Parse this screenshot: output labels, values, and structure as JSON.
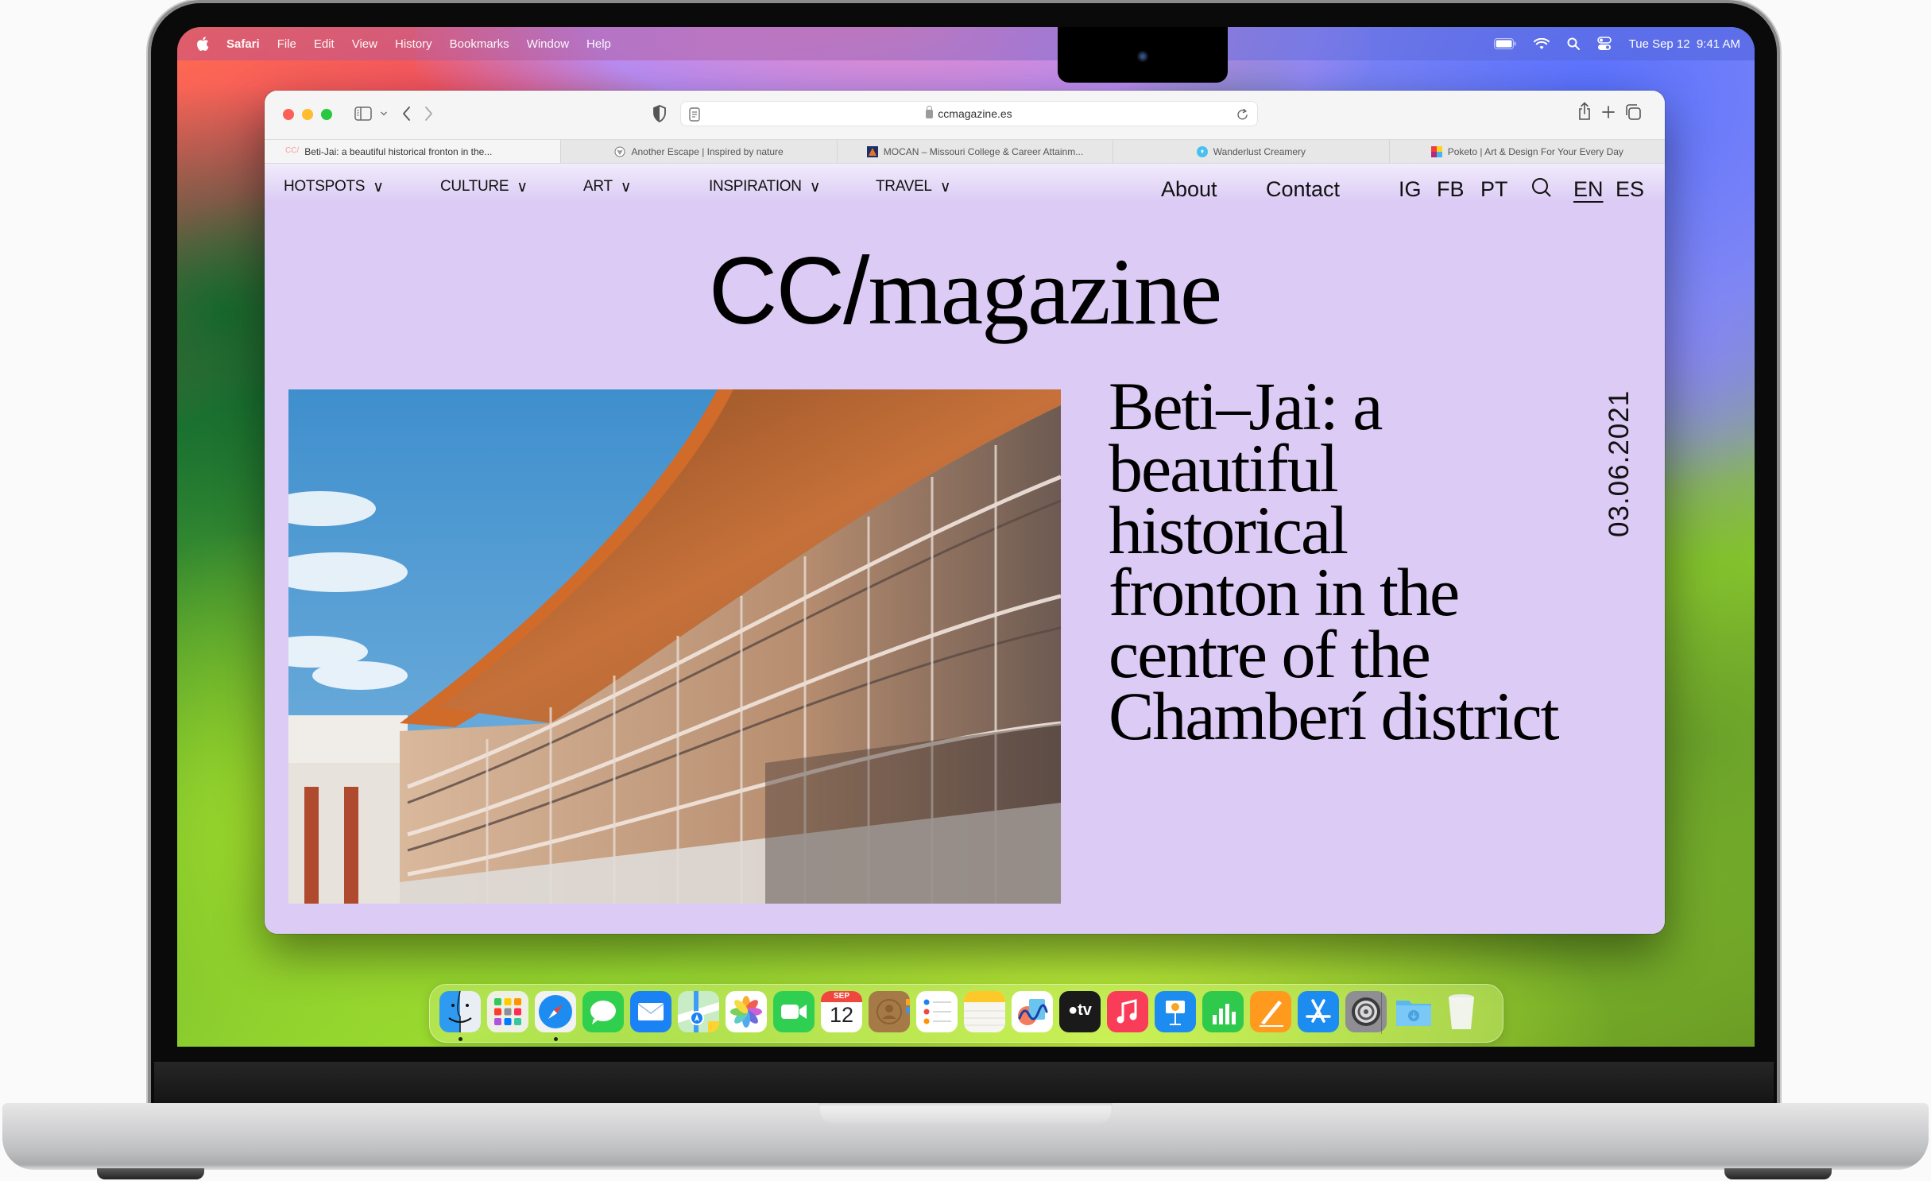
{
  "menubar": {
    "app_name": "Safari",
    "items": [
      "File",
      "Edit",
      "View",
      "History",
      "Bookmarks",
      "Window",
      "Help"
    ],
    "status_icons": [
      "battery-icon",
      "wifi-icon",
      "spotlight-search-icon",
      "control-center-icon"
    ],
    "clock": "Tue Sep 12  9:41 AM"
  },
  "safari": {
    "address": "ccmagazine.es",
    "tabs": [
      {
        "title": "Beti-Jai: a beautiful historical fronton in the...",
        "favicon": "cc-favicon",
        "active": true
      },
      {
        "title": "Another Escape | Inspired by nature",
        "favicon": "another-escape-favicon",
        "active": false
      },
      {
        "title": "MOCAN – Missouri College & Career Attainm...",
        "favicon": "mocan-favicon",
        "active": false
      },
      {
        "title": "Wanderlust Creamery",
        "favicon": "wanderlust-favicon",
        "active": false
      },
      {
        "title": "Poketo | Art & Design For Your Every Day",
        "favicon": "poketo-favicon",
        "active": false
      }
    ]
  },
  "page": {
    "nav_left": [
      {
        "label": "HOTSPOTS",
        "arrow": "∨"
      },
      {
        "label": "CULTURE",
        "arrow": "∨"
      },
      {
        "label": "ART",
        "arrow": "∨"
      },
      {
        "label": "INSPIRATION",
        "arrow": "∨"
      },
      {
        "label": "TRAVEL",
        "arrow": "∨"
      }
    ],
    "nav_right": {
      "about": "About",
      "contact": "Contact",
      "social": [
        "IG",
        "FB",
        "PT"
      ],
      "languages": [
        "EN",
        "ES"
      ],
      "active_language": "EN"
    },
    "masthead": {
      "prefix": "CC/",
      "suffix": "magazine"
    },
    "article": {
      "headline_lines": [
        "Beti–Jai: a",
        "beautiful historical",
        "fronton in the",
        "centre of the",
        "Chamberí district"
      ],
      "date": "03.06.2021",
      "image_alt": "Beti-Jai fronton arcade balconies under blue sky"
    },
    "background_color": "#dccbf5"
  },
  "dock": {
    "apps": [
      {
        "name": "Finder",
        "running": true
      },
      {
        "name": "Launchpad",
        "running": false
      },
      {
        "name": "Safari",
        "running": true
      },
      {
        "name": "Messages",
        "running": false
      },
      {
        "name": "Mail",
        "running": false
      },
      {
        "name": "Maps",
        "running": false
      },
      {
        "name": "Photos",
        "running": false
      },
      {
        "name": "FaceTime",
        "running": false
      },
      {
        "name": "Calendar",
        "running": false,
        "month": "SEP",
        "day": "12"
      },
      {
        "name": "Contacts",
        "running": false
      },
      {
        "name": "Reminders",
        "running": false
      },
      {
        "name": "Notes",
        "running": false
      },
      {
        "name": "Freeform",
        "running": false
      },
      {
        "name": "TV",
        "running": false,
        "label": "tv"
      },
      {
        "name": "Music",
        "running": false
      },
      {
        "name": "Keynote",
        "running": false
      },
      {
        "name": "Numbers",
        "running": false
      },
      {
        "name": "Pages",
        "running": false
      },
      {
        "name": "App Store",
        "running": false
      },
      {
        "name": "System Settings",
        "running": false
      }
    ],
    "stack": [
      {
        "name": "Downloads"
      },
      {
        "name": "Trash"
      }
    ]
  }
}
